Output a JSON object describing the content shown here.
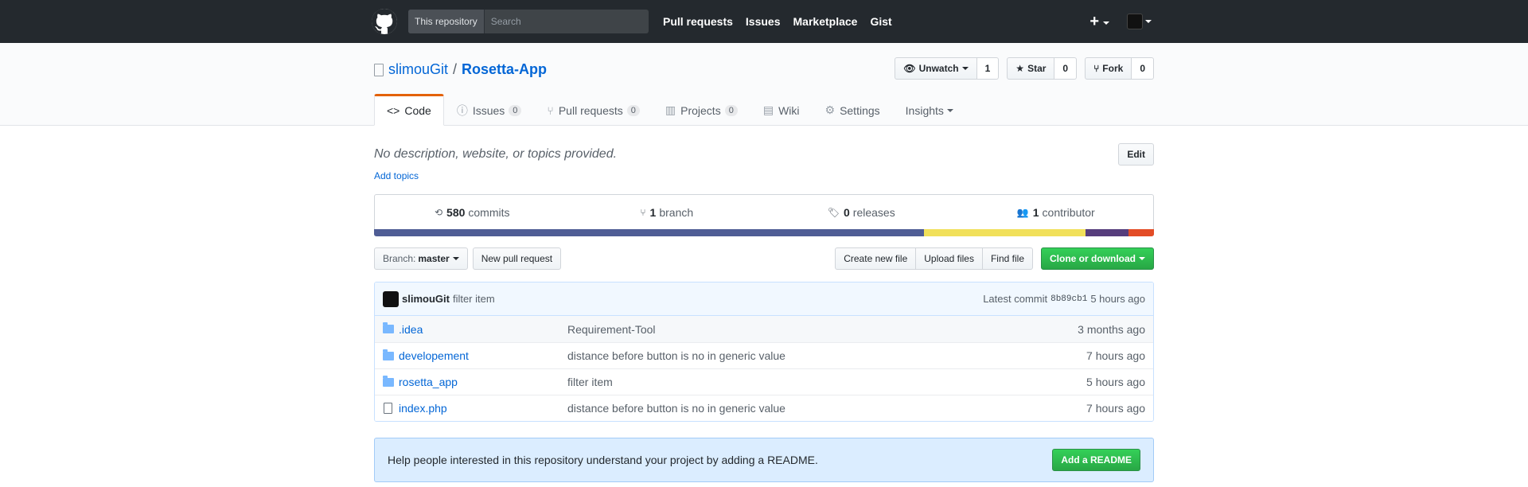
{
  "topbar": {
    "search_scope": "This repository",
    "search_placeholder": "Search",
    "nav": [
      "Pull requests",
      "Issues",
      "Marketplace",
      "Gist"
    ],
    "plus": "+"
  },
  "repo": {
    "owner": "slimouGit",
    "separator": "/",
    "name": "Rosetta-App",
    "watch_label": "Unwatch",
    "watch_count": "1",
    "star_label": "Star",
    "star_count": "0",
    "fork_label": "Fork",
    "fork_count": "0"
  },
  "tabs": [
    {
      "label": "Code",
      "icon": "code-icon",
      "glyph": "<>"
    },
    {
      "label": "Issues",
      "count": "0",
      "icon": "issue-icon",
      "glyph": "ⓘ"
    },
    {
      "label": "Pull requests",
      "count": "0",
      "icon": "pull-request-icon",
      "glyph": "⑂"
    },
    {
      "label": "Projects",
      "count": "0",
      "icon": "project-icon",
      "glyph": "▥"
    },
    {
      "label": "Wiki",
      "icon": "wiki-icon",
      "glyph": "▤"
    },
    {
      "label": "Settings",
      "icon": "gear-icon",
      "glyph": "⚙"
    },
    {
      "label": "Insights"
    }
  ],
  "main": {
    "description": "No description, website, or topics provided.",
    "add_topics": "Add topics",
    "edit": "Edit"
  },
  "summary": {
    "commits_count": "580",
    "commits_label": "commits",
    "branch_count": "1",
    "branch_label": "branch",
    "releases_count": "0",
    "releases_label": "releases",
    "contributors_count": "1",
    "contributors_label": "contributor"
  },
  "languages": [
    {
      "color": "#4F5D95",
      "percent": 70.5
    },
    {
      "color": "#f1e05a",
      "percent": 20.7
    },
    {
      "color": "#563d7c",
      "percent": 5.5
    },
    {
      "color": "#e34c26",
      "percent": 3.3
    }
  ],
  "toolbar": {
    "branch_prefix": "Branch:",
    "branch_name": "master",
    "new_pr": "New pull request",
    "create_file": "Create new file",
    "upload_files": "Upload files",
    "find_file": "Find file",
    "clone": "Clone or download"
  },
  "commit": {
    "author": "slimouGit",
    "message": "filter item",
    "latest_label": "Latest commit",
    "sha": "8b89cb1",
    "age": "5 hours ago"
  },
  "files": [
    {
      "name": ".idea",
      "type": "folder",
      "message": "Requirement-Tool",
      "age": "3 months ago"
    },
    {
      "name": "developement",
      "type": "folder",
      "message": "distance before button is no in generic value",
      "age": "7 hours ago"
    },
    {
      "name": "rosetta_app",
      "type": "folder",
      "message": "filter item",
      "age": "5 hours ago"
    },
    {
      "name": "index.php",
      "type": "file",
      "message": "distance before button is no in generic value",
      "age": "7 hours ago"
    }
  ],
  "readme": {
    "text": "Help people interested in this repository understand your project by adding a README.",
    "button": "Add a README"
  }
}
